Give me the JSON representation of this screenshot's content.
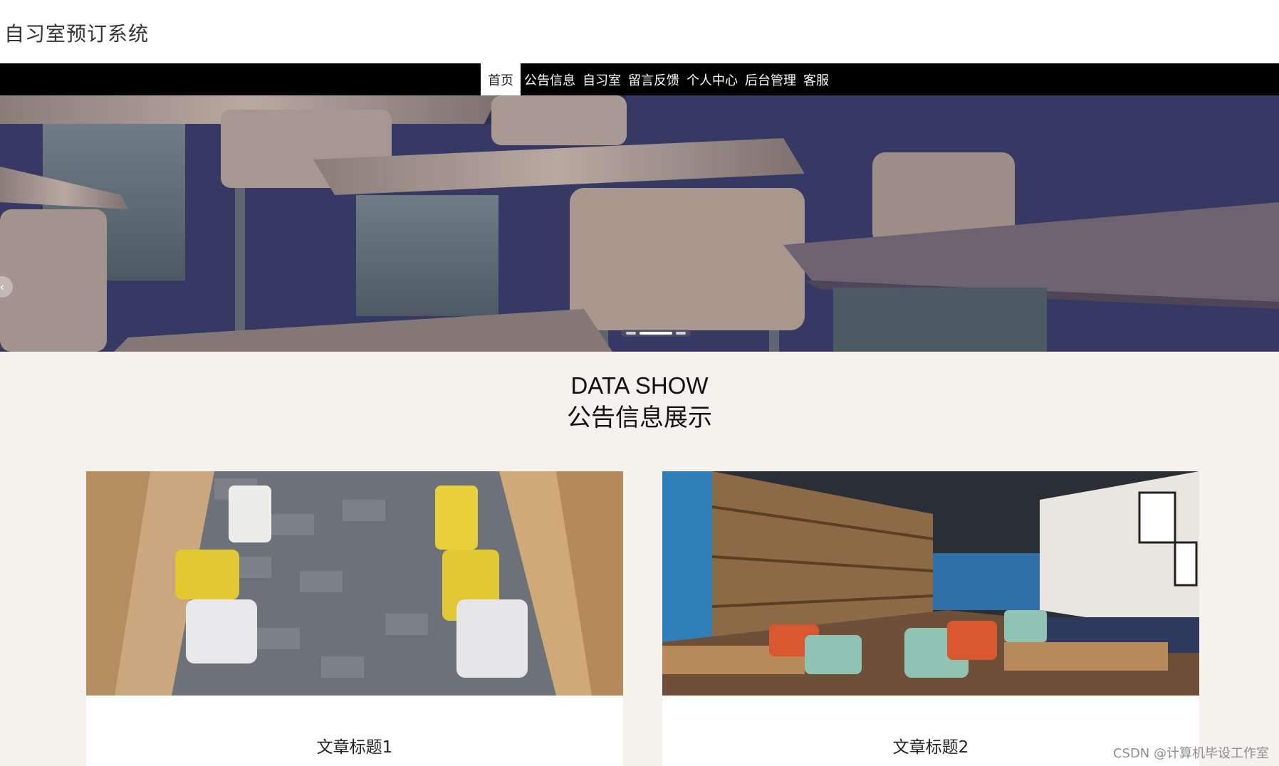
{
  "header": {
    "site_title": "自习室预订系统"
  },
  "nav": {
    "items": [
      "首页",
      "公告信息",
      "自习室",
      "留言反馈",
      "个人中心",
      "后台管理",
      "客服"
    ],
    "active_index": 0
  },
  "banner": {
    "prev_icon": "chevron-left-icon",
    "slide_count": 3,
    "active_slide": 1
  },
  "section": {
    "title_en": "DATA SHOW",
    "title_cn": "公告信息展示"
  },
  "cards": [
    {
      "title": "文章标题1"
    },
    {
      "title": "文章标题2"
    }
  ],
  "watermark": "CSDN @计算机毕设工作室",
  "colors": {
    "nav_bg": "#000000",
    "nav_active_bg": "#ffffff",
    "page_bg": "#f5f1ec"
  }
}
